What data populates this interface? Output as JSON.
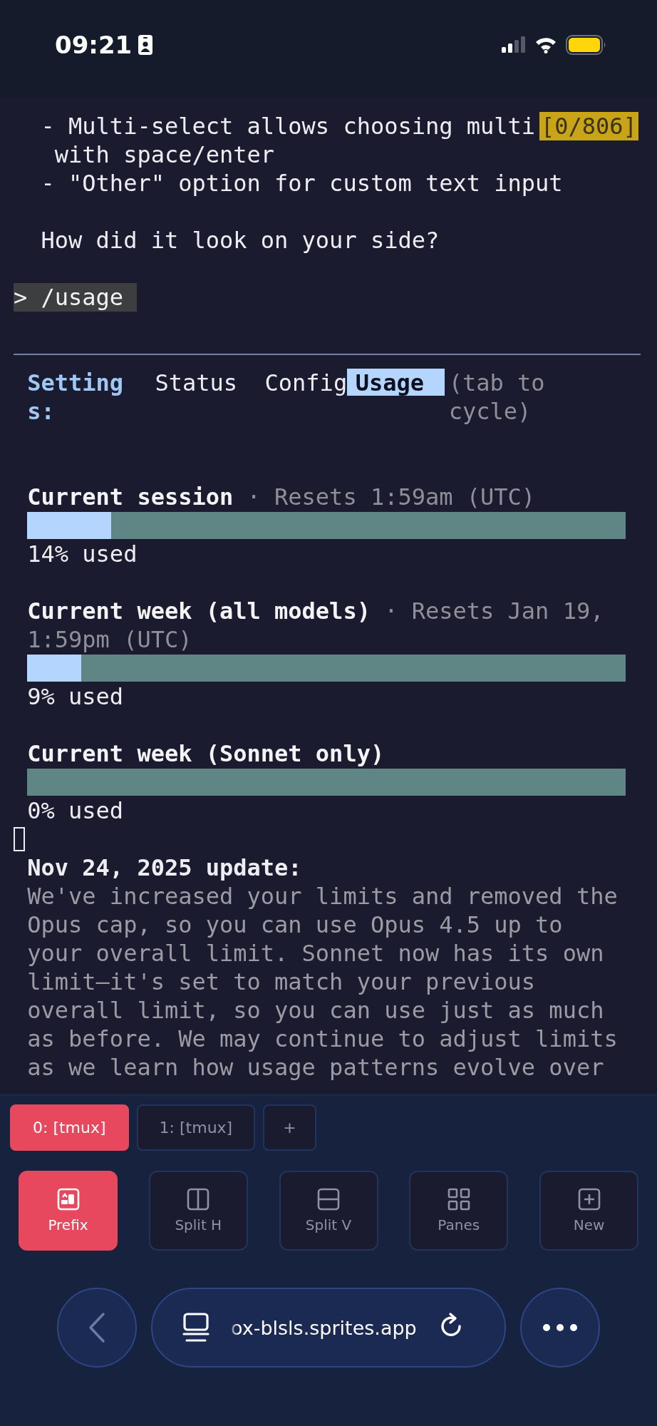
{
  "status_bar": {
    "time": "09:21"
  },
  "terminal": {
    "search_counter": "[0/806]",
    "transcript": {
      "lines": [
        "- Multi-select allows choosing multi",
        " with space/enter",
        "- \"Other\" option for custom text input"
      ],
      "question": "How did it look on your side?"
    },
    "prompt": "> /usage",
    "settings": {
      "title": "Settings:",
      "tabs": [
        {
          "label": "Status",
          "selected": false
        },
        {
          "label": "Config",
          "selected": false
        },
        {
          "label": "Usage",
          "selected": true
        }
      ],
      "hint": "(tab to cycle)"
    },
    "meters": [
      {
        "label": "Current session",
        "resets": "· Resets 1:59am (UTC)",
        "level": 0.14,
        "reading": "14% used"
      },
      {
        "label": "Current week (all models)",
        "resets": "· Resets Jan 19, 1:59pm (UTC)",
        "level": 0.09,
        "reading": "9% used"
      },
      {
        "label": "Current week (Sonnet only)",
        "reading": "0% used"
      }
    ],
    "update": {
      "heading": "Nov 24, 2025 update:",
      "body": "We've increased your limits and removed the Opus cap, so you can use Opus 4.5 up to your overall limit. Sonnet now has its own limit—it's set to match your previous overall limit, so you can use just as much as before. We may continue to adjust limits as we learn how usage patterns evolve over"
    }
  },
  "tmux": {
    "windows": [
      {
        "label": "0: [tmux]",
        "selected": true
      },
      {
        "label": "1: [tmux]",
        "selected": false
      }
    ],
    "new_window": "+",
    "tools": [
      {
        "kind": "prefix",
        "label": "Prefix",
        "on": true
      },
      {
        "kind": "split_h",
        "label": "Split H",
        "on": false
      },
      {
        "kind": "split_v",
        "label": "Split V",
        "on": false
      },
      {
        "kind": "panes",
        "label": "Panes",
        "on": false
      },
      {
        "kind": "new",
        "label": "New",
        "on": false
      }
    ]
  },
  "browser": {
    "url": "ox-blsls.sprites.app"
  }
}
